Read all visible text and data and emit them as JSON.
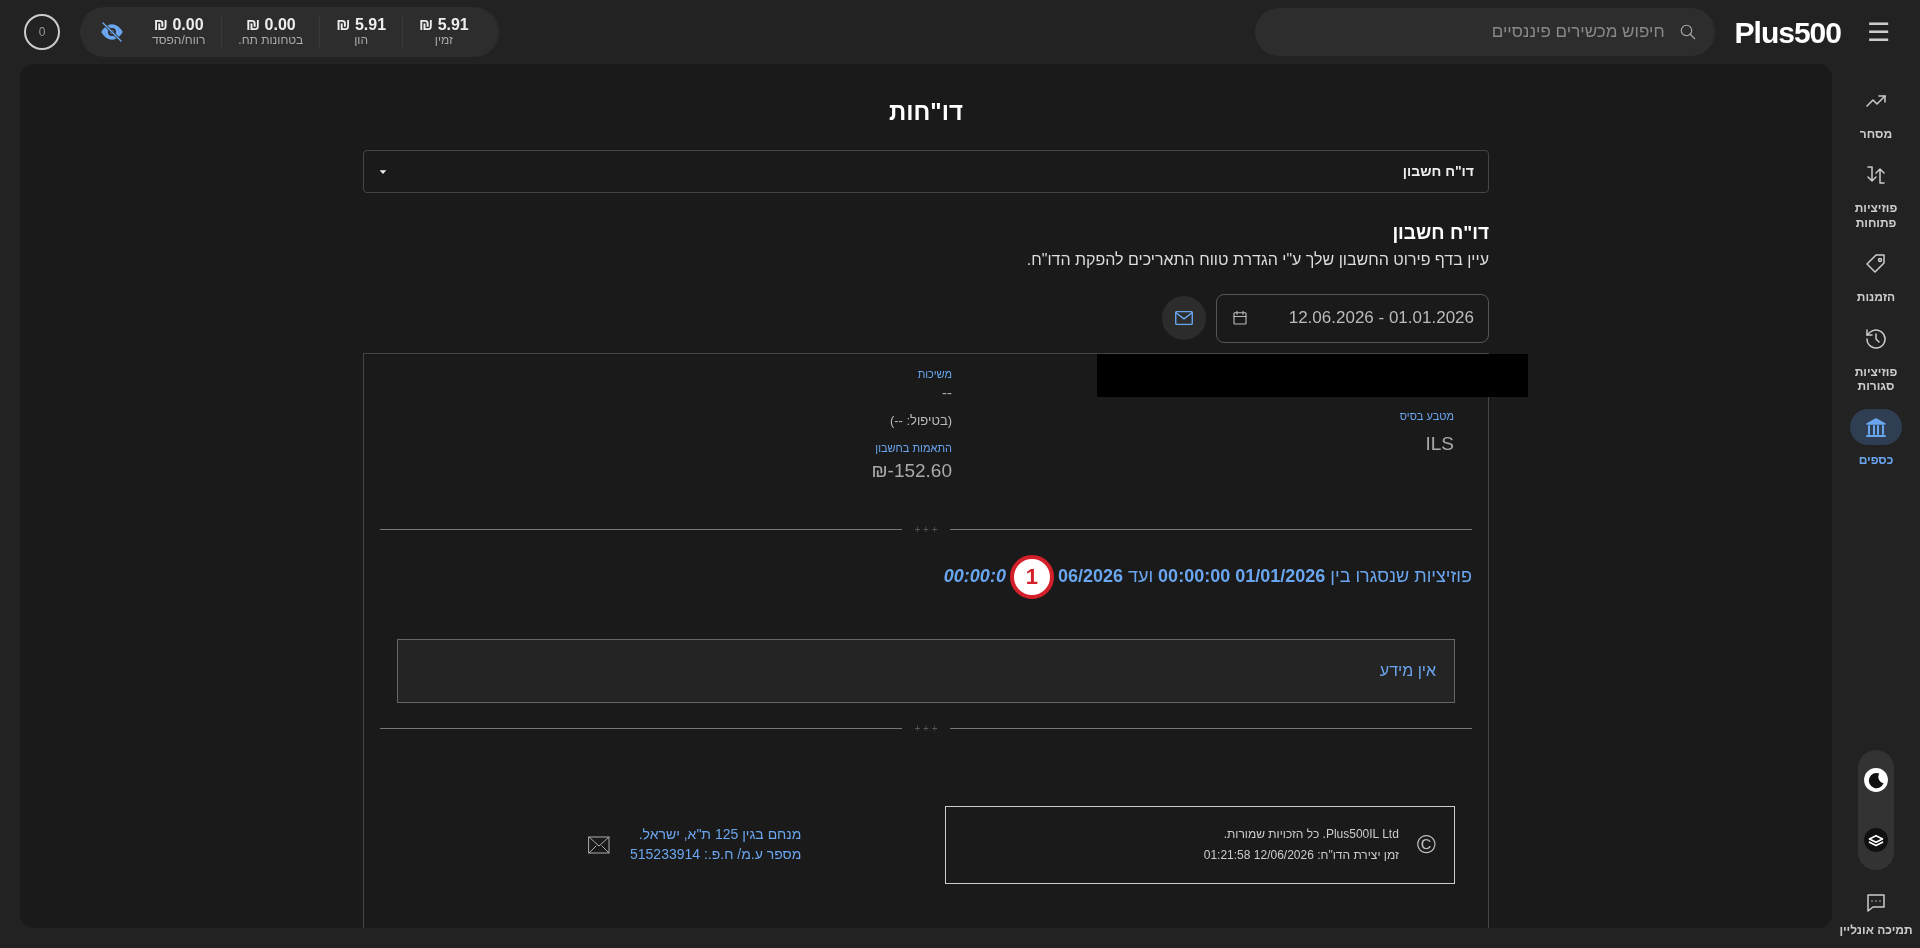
{
  "header": {
    "menu_icon": "☰",
    "logo": "Plus500",
    "search": {
      "placeholder": "חיפוש מכשירים פיננסיים"
    },
    "stats": [
      {
        "value": "5.91 ₪",
        "label": "זמין"
      },
      {
        "value": "5.91 ₪",
        "label": "הון"
      },
      {
        "value": "0.00 ₪",
        "label": "בטחונות תח."
      },
      {
        "value": "0.00 ₪",
        "label": "רווח/הפסד"
      }
    ],
    "avatar": "0"
  },
  "sidebar": {
    "items": [
      {
        "kind": "trend",
        "label": "מסחר",
        "selected": false
      },
      {
        "kind": "open",
        "label": "פוזיציות פתוחות",
        "selected": false
      },
      {
        "kind": "tag",
        "label": "הזמנות",
        "selected": false
      },
      {
        "kind": "history",
        "label": "פוזיציות סגורות",
        "selected": false
      },
      {
        "kind": "bank",
        "label": "כספים",
        "selected": true
      }
    ],
    "support": "תמיכה אונליין"
  },
  "page": {
    "title": "דו\"חות",
    "report_select": "דו\"ח חשבון",
    "section_title": "דו\"ח חשבון",
    "description": "עיין בדף פירוט החשבון שלך ע\"י הגדרת טווח התאריכים להפקת הדו\"ח.",
    "date_range": "01.01.2026 - 12.06.2026"
  },
  "report": {
    "fields_right": [
      {
        "label": "מטבע בסיס",
        "value": "ILS"
      }
    ],
    "withdrawals": {
      "label": "משיכות",
      "value": "--",
      "pending": "(בטיפול: --)"
    },
    "adjustments": {
      "label": "התאמות בחשבון",
      "value": "₪-152.60"
    },
    "dividers": [
      "+ + +",
      "+ + +"
    ],
    "closed_title": "פוזיציות שנסגרו בין **01/01/2026 00:00:00** ועד **06/2026**",
    "closed_title_tail": "00:00:0",
    "marker": "1",
    "no_data": "אין מידע",
    "footer": {
      "copyright_symbol": "©",
      "rights": "Plus500IL Ltd. כל הזכויות שמורות.",
      "created": "זמן יצירת הדו\"ח: 12/06/2026 01:21:58",
      "address": "מנחם בגין 125 ת\"א, ישראל.",
      "company_id": "מספר ע.מ/ ח.פ.: 515233914"
    }
  }
}
